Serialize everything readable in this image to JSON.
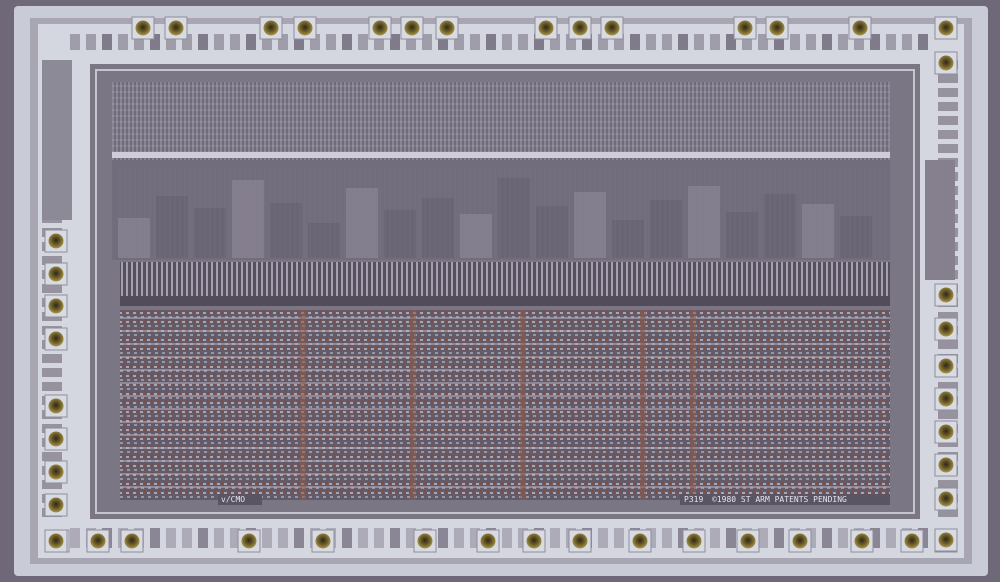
{
  "image": {
    "subject": "integrated circuit die micrograph",
    "palette": {
      "background": "#6e6878",
      "frame_metal": "#c9ccd6",
      "frame_shadow": "#8e8b9a",
      "core": "#7b7683",
      "core_dark": "#5a5562",
      "upper_array": "#716d7b",
      "lower_array": "#6c6470",
      "array_rows": "#b8b3c2",
      "pad_gold": "#8a7a3c",
      "pad_center": "#4a4030",
      "copper_trace": "#9c6a54"
    }
  },
  "die_markings": {
    "logo_text": "v/CMO",
    "part_number": "P319",
    "copyright": "©1980 ST  ARM PATENTS PENDING"
  },
  "bond_pads": {
    "top_count": 14,
    "bottom_count": 16,
    "left_count": 9,
    "right_count": 9
  }
}
